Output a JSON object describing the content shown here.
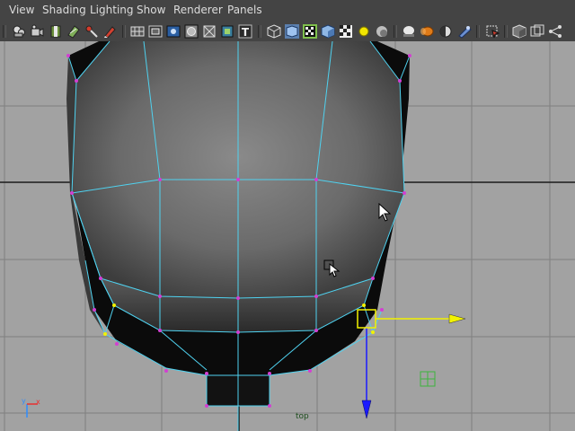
{
  "menus": [
    "View",
    "Shading",
    "Lighting",
    "Show",
    "Renderer",
    "Panels"
  ],
  "toolbar": {
    "icons": [
      "camera-select-icon",
      "camera-attributes-icon",
      "bookmark-icon",
      "image-plane-icon",
      "two-d-pan-zoom-icon",
      "grease-pencil-icon",
      "grid-icon",
      "film-gate-icon",
      "resolution-gate-icon",
      "gate-mask-icon",
      "field-chart-icon",
      "safe-action-icon",
      "safe-title-icon",
      "wireframe-icon",
      "smooth-shade-icon",
      "wireframe-on-shaded-icon",
      "default-material-icon",
      "textured-icon",
      "use-all-lights-icon",
      "shadows-icon",
      "screen-space-ambient-occlusion-icon",
      "motion-blur-icon",
      "multisample-aa-icon",
      "depth-of-field-icon",
      "isolate-select-icon",
      "xray-icon",
      "xray-joints-icon",
      "xray-active-icon"
    ]
  },
  "viewport": {
    "camera_label": "top",
    "axis_labels": {
      "x": "x",
      "y": "y"
    }
  }
}
